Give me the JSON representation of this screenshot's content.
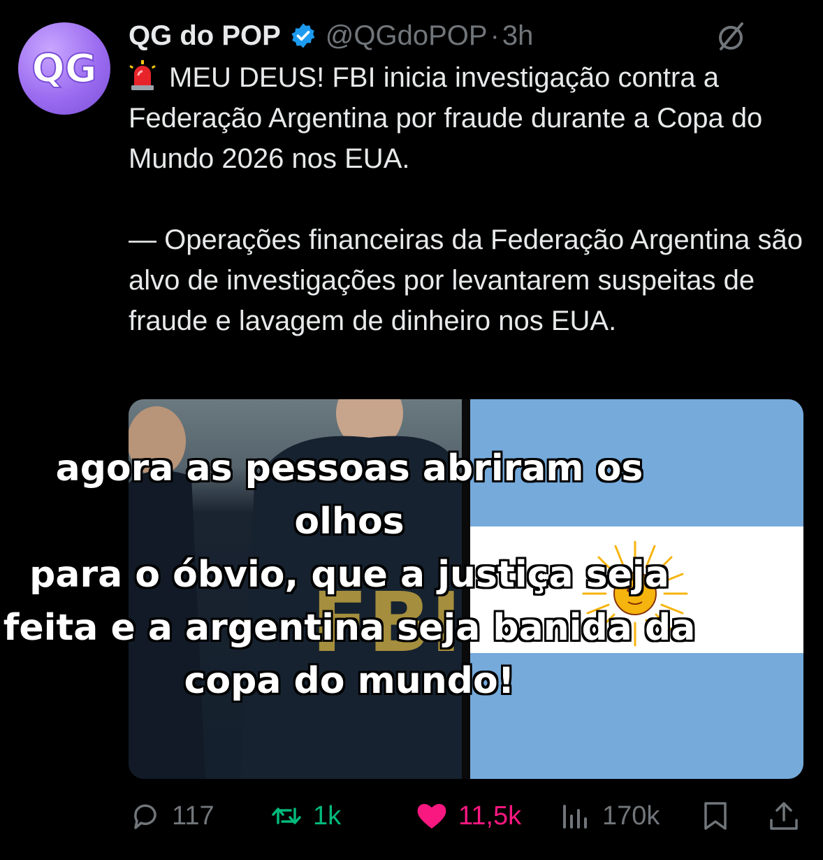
{
  "tweet": {
    "author_name": "QG do POP",
    "handle": "@QGdoPOP",
    "separator": "·",
    "time": "3h",
    "avatar_text": "QG",
    "text_line1": "MEU DEUS! FBI inicia investigação contra a Federação Argentina por fraude durante a Copa do Mundo 2026 nos EUA.",
    "text_line2": "— Operações financeiras da Federação Argentina são alvo de investigações por levantarem suspeitas de fraude e lavagem de dinheiro nos EUA.",
    "media_left_text": "FBI",
    "overlay_caption": [
      "agora as pessoas abriram os olhos",
      "para o óbvio, que a justiça seja",
      "feita e a argentina seja banida da",
      "copa do mundo!"
    ]
  },
  "actions": {
    "replies": "117",
    "reposts": "1k",
    "likes": "11,5k",
    "views": "170k"
  },
  "colors": {
    "background": "#000000",
    "text": "#e7e9ea",
    "muted": "#71767b",
    "verified": "#1d9bf0",
    "repost": "#00ba7c",
    "like": "#f91880",
    "flag_blue": "#75aadb"
  },
  "icons": [
    "verified-badge-icon",
    "grok-icon",
    "siren-icon",
    "reply-icon",
    "repost-icon",
    "like-icon",
    "views-icon",
    "bookmark-icon",
    "share-icon"
  ]
}
